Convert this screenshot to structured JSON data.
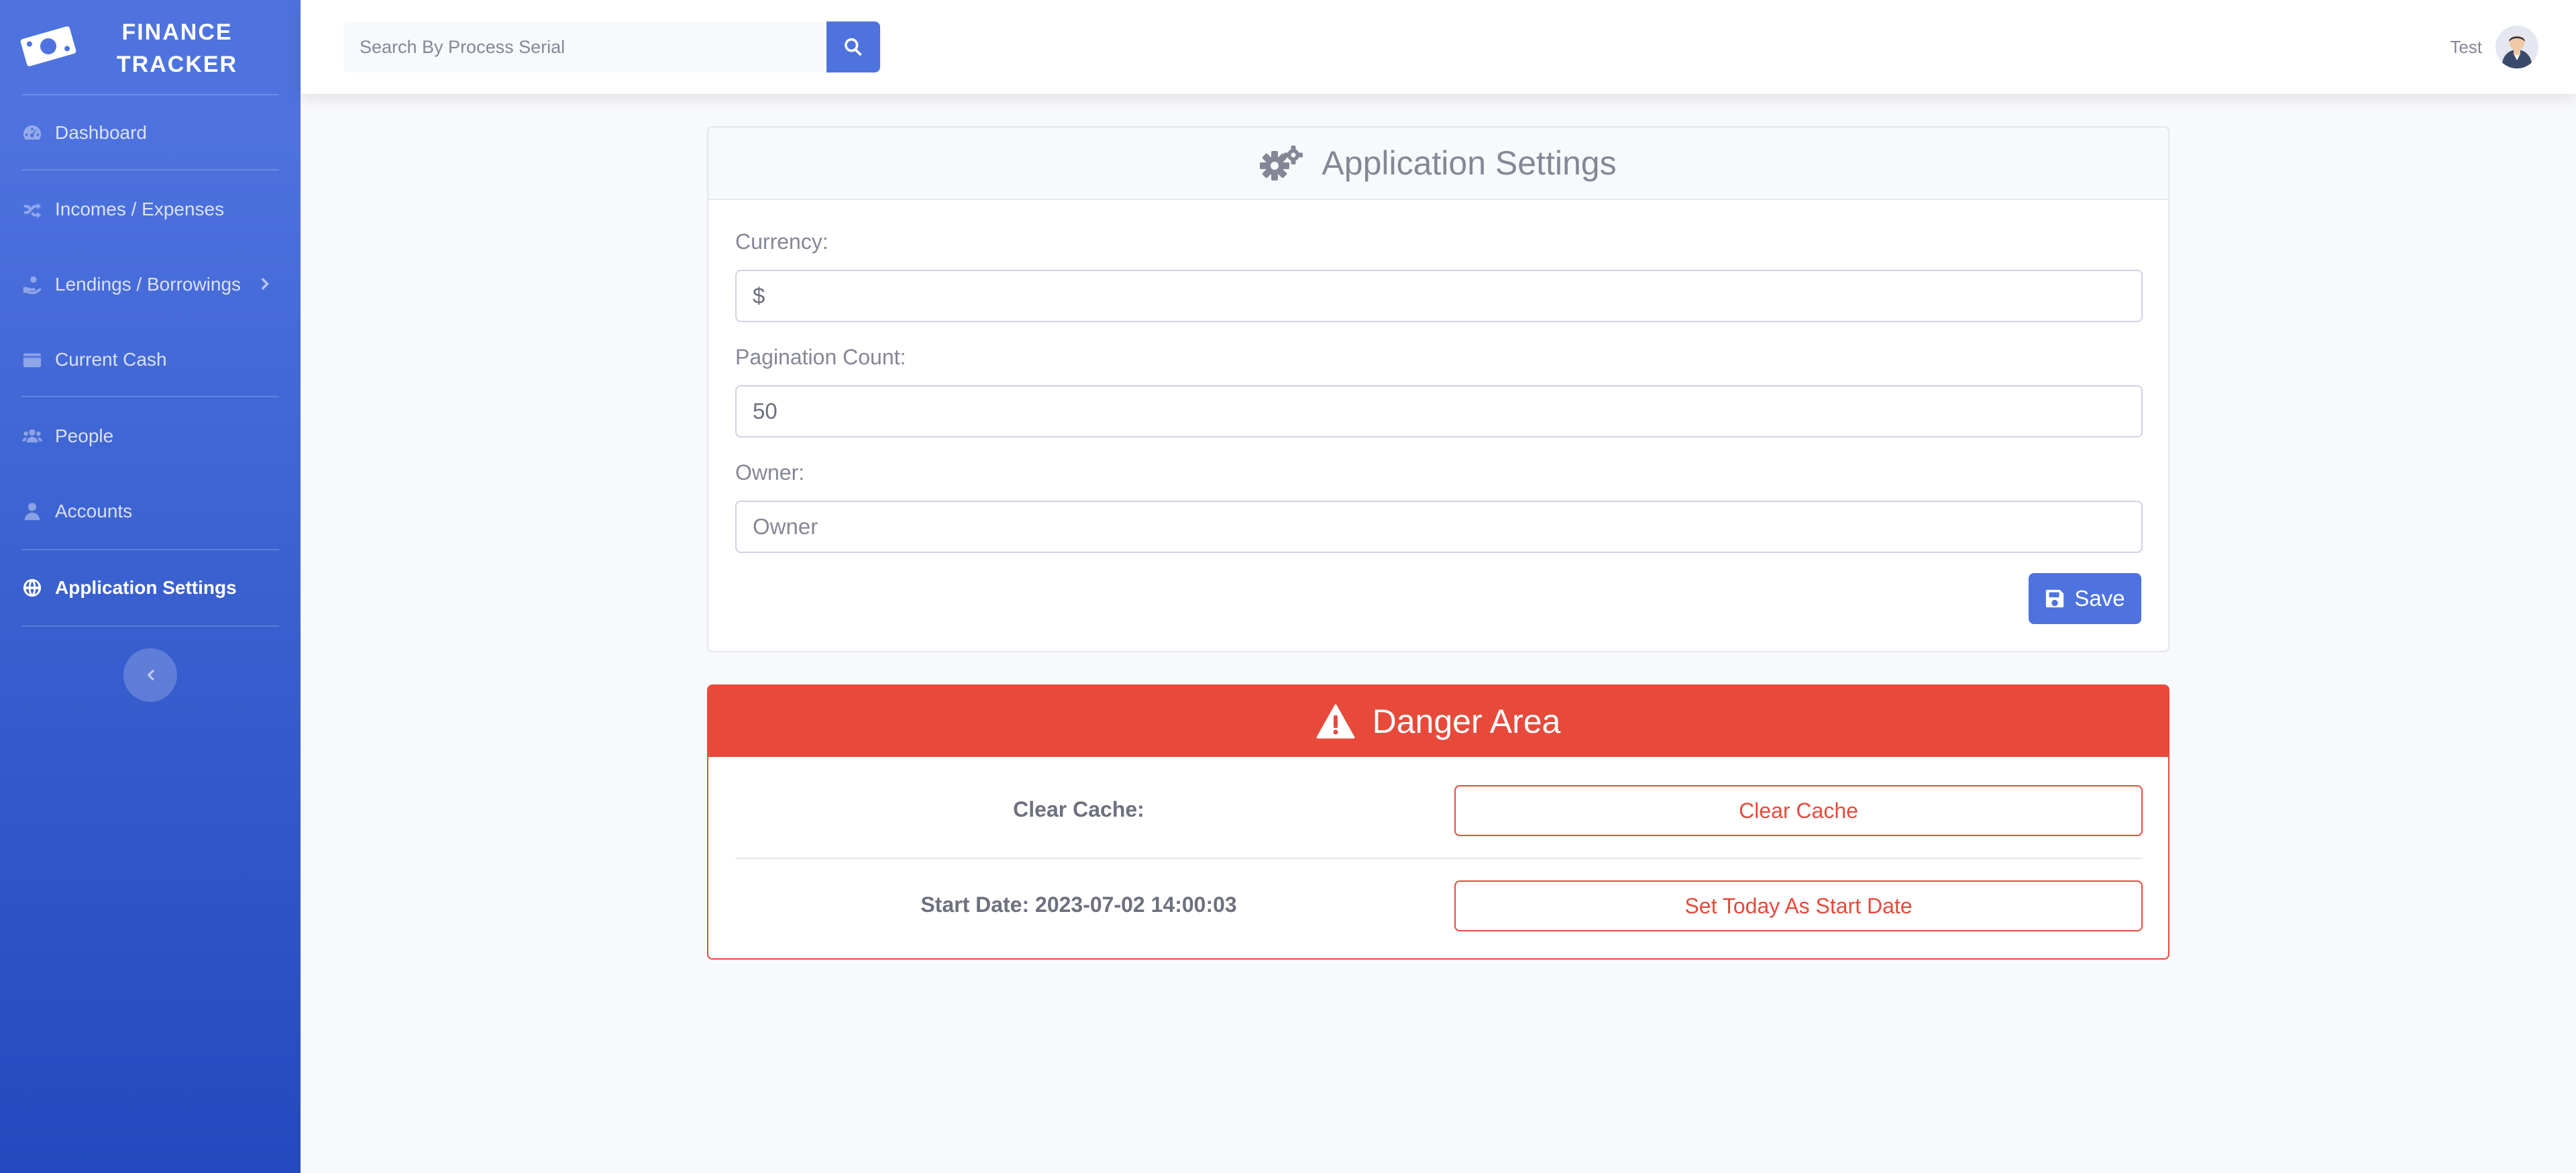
{
  "brand": {
    "line1": "FINANCE",
    "line2": "TRACKER",
    "logo_icon": "money-bill-icon"
  },
  "sidebar": {
    "items": [
      {
        "label": "Dashboard",
        "icon": "tachometer-icon",
        "active": false
      },
      {
        "label": "Incomes / Expenses",
        "icon": "random-icon",
        "active": false
      },
      {
        "label": "Lendings / Borrowings",
        "icon": "hand-holding-icon",
        "active": false,
        "has_submenu": true
      },
      {
        "label": "Current Cash",
        "icon": "wallet-icon",
        "active": false
      },
      {
        "label": "People",
        "icon": "users-icon",
        "active": false
      },
      {
        "label": "Accounts",
        "icon": "user-icon",
        "active": false
      },
      {
        "label": "Application Settings",
        "icon": "globe-icon",
        "active": true
      }
    ],
    "toggle_icon": "chevron-left-icon"
  },
  "topbar": {
    "search": {
      "placeholder": "Search By Process Serial",
      "value": ""
    },
    "user": {
      "name": "Test"
    }
  },
  "settings": {
    "title": "Application Settings",
    "fields": {
      "currency": {
        "label": "Currency:",
        "value": "$",
        "placeholder": ""
      },
      "pagination": {
        "label": "Pagination Count:",
        "value": "50",
        "placeholder": ""
      },
      "owner": {
        "label": "Owner:",
        "value": "",
        "placeholder": "Owner"
      }
    },
    "save_label": "Save"
  },
  "danger": {
    "title": "Danger Area",
    "clear_cache_label": "Clear Cache:",
    "clear_cache_button": "Clear Cache",
    "start_date_label": "Start Date: 2023-07-02 14:00:03",
    "start_date_button": "Set Today As Start Date"
  },
  "colors": {
    "primary": "#4e73df",
    "danger": "#e74a3b",
    "background": "#f8f9fc"
  }
}
